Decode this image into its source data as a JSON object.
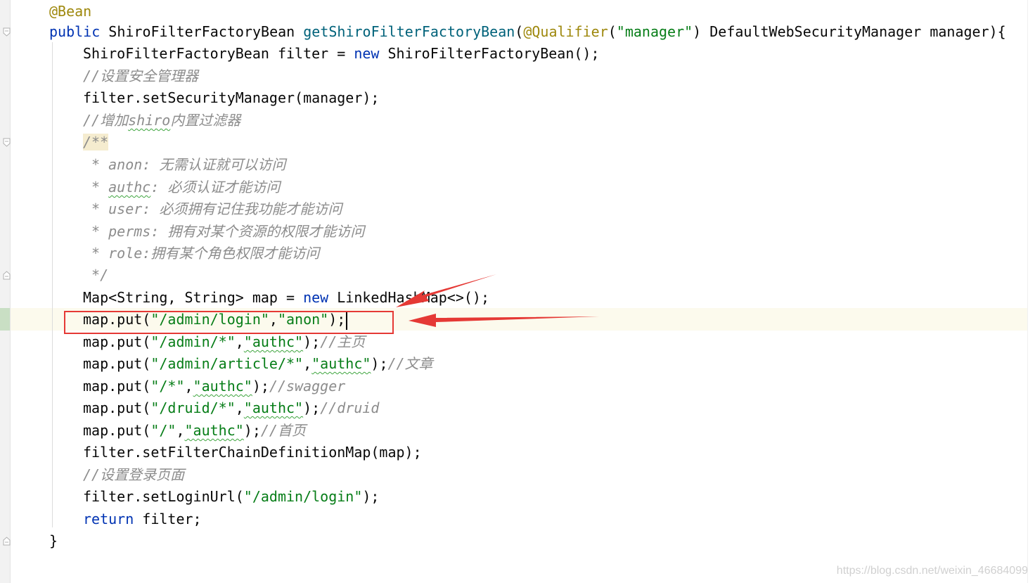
{
  "editor": {
    "lines": [
      {
        "id": "l1",
        "tokens": [
          {
            "t": "@Bean",
            "c": "ann"
          }
        ]
      },
      {
        "id": "l2",
        "tokens": [
          {
            "t": "public ",
            "c": "kw"
          },
          {
            "t": "ShiroFilterFactoryBean ",
            "c": ""
          },
          {
            "t": "getShiroFilterFactoryBean",
            "c": "fn"
          },
          {
            "t": "(",
            "c": ""
          },
          {
            "t": "@Qualifier",
            "c": "ann"
          },
          {
            "t": "(",
            "c": ""
          },
          {
            "t": "\"manager\"",
            "c": "str"
          },
          {
            "t": ") DefaultWebSecurityManager manager){",
            "c": ""
          }
        ]
      },
      {
        "id": "l3",
        "tokens": [
          {
            "t": "ShiroFilterFactoryBean filter = ",
            "c": ""
          },
          {
            "t": "new ",
            "c": "kw"
          },
          {
            "t": "ShiroFilterFactoryBean();",
            "c": ""
          }
        ]
      },
      {
        "id": "l4",
        "tokens": [
          {
            "t": "//设置安全管理器",
            "c": "cmt"
          }
        ]
      },
      {
        "id": "l5",
        "tokens": [
          {
            "t": "filter.setSecurityManager(manager);",
            "c": ""
          }
        ]
      },
      {
        "id": "l6",
        "tokens": [
          {
            "t": "//增加",
            "c": "cmt"
          },
          {
            "t": "shiro",
            "c": "cmt squig"
          },
          {
            "t": "内置过滤器",
            "c": "cmt"
          }
        ]
      },
      {
        "id": "l7",
        "tokens": [
          {
            "t": "/**",
            "c": "doc docopen"
          }
        ]
      },
      {
        "id": "l8",
        "tokens": [
          {
            "t": " * anon: 无需认证就可以访问",
            "c": "doc"
          }
        ]
      },
      {
        "id": "l9",
        "tokens": [
          {
            "t": " * ",
            "c": "doc"
          },
          {
            "t": "authc",
            "c": "doc squig"
          },
          {
            "t": ": 必须认证才能访问",
            "c": "doc"
          }
        ]
      },
      {
        "id": "l10",
        "tokens": [
          {
            "t": " * user: 必须拥有记住我功能才能访问",
            "c": "doc"
          }
        ]
      },
      {
        "id": "l11",
        "tokens": [
          {
            "t": " * perms: 拥有对某个资源的权限才能访问",
            "c": "doc"
          }
        ]
      },
      {
        "id": "l12",
        "tokens": [
          {
            "t": " * role:拥有某个角色权限才能访问",
            "c": "doc"
          }
        ]
      },
      {
        "id": "l13",
        "tokens": [
          {
            "t": " */",
            "c": "doc"
          }
        ]
      },
      {
        "id": "l14",
        "tokens": [
          {
            "t": "Map<String, String> map = ",
            "c": ""
          },
          {
            "t": "new ",
            "c": "kw"
          },
          {
            "t": "LinkedHashMap<>();",
            "c": ""
          }
        ]
      },
      {
        "id": "l15",
        "tokens": [
          {
            "t": "map.put(",
            "c": ""
          },
          {
            "t": "\"/admin/login\"",
            "c": "str"
          },
          {
            "t": ",",
            "c": ""
          },
          {
            "t": "\"anon\"",
            "c": "str"
          },
          {
            "t": ");",
            "c": ""
          }
        ],
        "caret": true
      },
      {
        "id": "l16",
        "tokens": [
          {
            "t": "map.put(",
            "c": ""
          },
          {
            "t": "\"/admin/*\"",
            "c": "str"
          },
          {
            "t": ",",
            "c": ""
          },
          {
            "t": "\"authc\"",
            "c": "str squig"
          },
          {
            "t": ");",
            "c": ""
          },
          {
            "t": "//主页",
            "c": "cmt"
          }
        ]
      },
      {
        "id": "l17",
        "tokens": [
          {
            "t": "map.put(",
            "c": ""
          },
          {
            "t": "\"/admin/article/*\"",
            "c": "str"
          },
          {
            "t": ",",
            "c": ""
          },
          {
            "t": "\"authc\"",
            "c": "str squig"
          },
          {
            "t": ");",
            "c": ""
          },
          {
            "t": "//文章",
            "c": "cmt"
          }
        ]
      },
      {
        "id": "l18",
        "tokens": [
          {
            "t": "map.put(",
            "c": ""
          },
          {
            "t": "\"/*\"",
            "c": "str"
          },
          {
            "t": ",",
            "c": ""
          },
          {
            "t": "\"authc\"",
            "c": "str squig"
          },
          {
            "t": ");",
            "c": ""
          },
          {
            "t": "//swagger",
            "c": "cmt"
          }
        ]
      },
      {
        "id": "l19",
        "tokens": [
          {
            "t": "map.put(",
            "c": ""
          },
          {
            "t": "\"/druid/*\"",
            "c": "str"
          },
          {
            "t": ",",
            "c": ""
          },
          {
            "t": "\"authc\"",
            "c": "str squig"
          },
          {
            "t": ");",
            "c": ""
          },
          {
            "t": "//druid",
            "c": "cmt"
          }
        ]
      },
      {
        "id": "l20",
        "tokens": [
          {
            "t": "map.put(",
            "c": ""
          },
          {
            "t": "\"/\"",
            "c": "str"
          },
          {
            "t": ",",
            "c": ""
          },
          {
            "t": "\"authc\"",
            "c": "str squig"
          },
          {
            "t": ");",
            "c": ""
          },
          {
            "t": "//首页",
            "c": "cmt"
          }
        ]
      },
      {
        "id": "l21",
        "tokens": [
          {
            "t": "filter.setFilterChainDefinitionMap(map);",
            "c": ""
          }
        ]
      },
      {
        "id": "l22",
        "tokens": [
          {
            "t": "//设置登录页面",
            "c": "cmt"
          }
        ]
      },
      {
        "id": "l23",
        "tokens": [
          {
            "t": "filter.setLoginUrl(",
            "c": ""
          },
          {
            "t": "\"/admin/login\"",
            "c": "str"
          },
          {
            "t": ");",
            "c": ""
          }
        ]
      },
      {
        "id": "l24",
        "tokens": [
          {
            "t": "return ",
            "c": "kw"
          },
          {
            "t": "filter;",
            "c": ""
          }
        ]
      },
      {
        "id": "l25",
        "tokens": [
          {
            "t": "}",
            "c": ""
          }
        ]
      }
    ]
  },
  "watermark": "https://blog.csdn.net/weixin_46684099",
  "colors": {
    "keyword": "#0033b3",
    "annotation": "#9e880d",
    "string": "#067d17",
    "comment": "#8c8c8c",
    "method": "#00627a",
    "highlight_box": "#e53935",
    "arrow": "#e53935"
  }
}
